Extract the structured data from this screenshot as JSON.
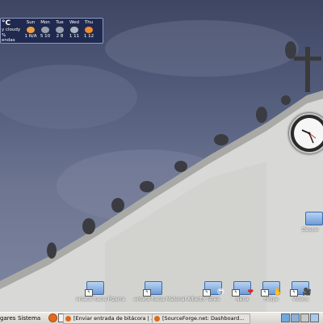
{
  "weather": {
    "current_temp": "°C",
    "condition": "y cloudy",
    "unit_symbol": "%",
    "location": "endas",
    "days": [
      {
        "name": "Sun",
        "range": "1 N/A"
      },
      {
        "name": "Mon",
        "range": "5 10"
      },
      {
        "name": "Tue",
        "range": "2 8"
      },
      {
        "name": "Wed",
        "range": "1 11"
      },
      {
        "name": "Thu",
        "range": "1 12"
      }
    ]
  },
  "desktop_icons": [
    {
      "label": "enlace hacia Pizarra",
      "emblem": ""
    },
    {
      "label": "enlace hacia Material Alberto",
      "emblem": ""
    },
    {
      "label": "Tárea",
      "emblem": "😎"
    },
    {
      "label": "Nena",
      "emblem": "❤"
    },
    {
      "label": "Felipe",
      "emblem": "✋"
    },
    {
      "label": "Videos",
      "emblem": "🎥"
    },
    {
      "label": "Descar",
      "emblem": ""
    }
  ],
  "taskbar": {
    "menu_places": "gares",
    "menu_system": "Sistema",
    "tasks": [
      {
        "label": "[Enviar entrada de bitácora | ..."
      },
      {
        "label": "[SourceForge.net: Dashboard..."
      }
    ]
  },
  "colors": {
    "sky": "#56607f",
    "wall": "#dcdcdc",
    "taskbar": "#d6d3cd",
    "weather_bg": "#182248"
  }
}
